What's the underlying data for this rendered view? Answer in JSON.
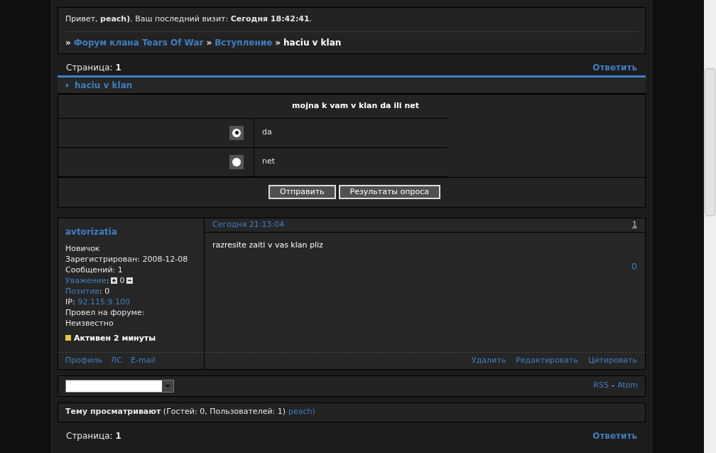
{
  "header": {
    "greeting": "Привет, **peach)**.  Ваш последний визит: **Сегодня 18:42:41**.",
    "breadcrumbs": [
      {
        "separator": "»",
        "label": "Форум клана Tears Of War",
        "link": true
      },
      {
        "separator": "»",
        "label": "Вступление",
        "link": true
      },
      {
        "separator": "»",
        "label": "haciu v klan",
        "link": false
      }
    ]
  },
  "pager_top": {
    "label": "Страница:",
    "page": "1",
    "reply": "Ответить"
  },
  "topic": {
    "title": "haciu v klan"
  },
  "poll": {
    "question": "mojna k vam v klan da ili net",
    "options": [
      {
        "label": "da",
        "selected": true
      },
      {
        "label": "net",
        "selected": false
      }
    ],
    "buttons": [
      "Отправить",
      "Результаты опроса"
    ]
  },
  "post": {
    "author": "avtorizatia",
    "rank": "Новичок",
    "fields": [
      {
        "kind": "text",
        "label": "Зарегистрирован:",
        "value": "2008-12-08"
      },
      {
        "kind": "text",
        "label": "Сообщений:",
        "value": "1"
      },
      {
        "kind": "vote",
        "label": "Уважение",
        "colon": ":",
        "value": "0"
      },
      {
        "kind": "link",
        "label": "Позитив",
        "value": ": 0"
      },
      {
        "kind": "ip",
        "label": "IP:",
        "value": "92.115.9.100"
      },
      {
        "kind": "block",
        "label": "Провел на форуме:",
        "value": "Неизвестно"
      }
    ],
    "status": "Активен 2 минуты",
    "profile_links": [
      "Профиль",
      "ЛС",
      "E-mail"
    ],
    "date": "Сегодня 21:13:04",
    "number": "1",
    "body": "razresite zaiti v vas klan pliz",
    "rating": "0",
    "actions": [
      "Удалить",
      "Редактировать",
      "Цитировать"
    ]
  },
  "footer": {
    "feeds": [
      "RSS",
      "Atom"
    ],
    "feed_separator": "-"
  },
  "viewers": {
    "text": "**Тему просматривают** (Гостей: 0, Пользователей: 1)",
    "user": "peach)"
  },
  "pager_bottom": {
    "label": "Страница:",
    "page": "1",
    "reply": "Ответить"
  }
}
